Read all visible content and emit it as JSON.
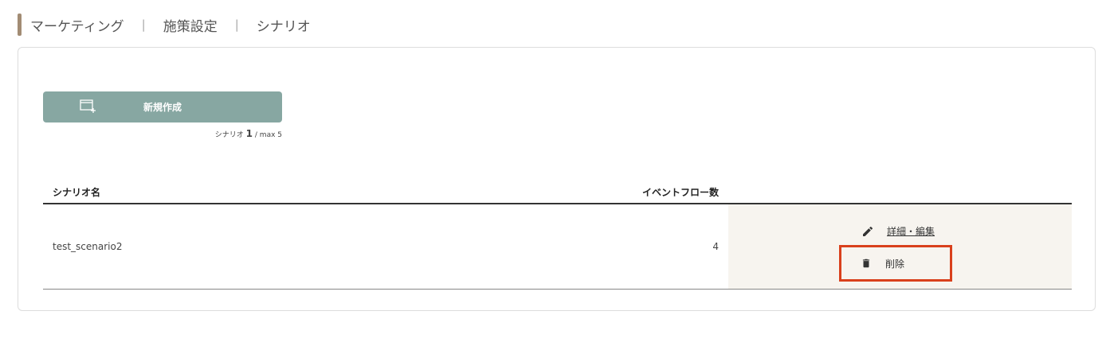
{
  "breadcrumb": {
    "items": [
      "マーケティング",
      "施策設定",
      "シナリオ"
    ],
    "separator": "|"
  },
  "toolbar": {
    "new_button_label": "新規作成",
    "new_icon": "new-window-icon",
    "count_prefix": "シナリオ",
    "count_current": "1",
    "count_suffix": "/ max 5"
  },
  "table": {
    "headers": {
      "name": "シナリオ名",
      "event_flow_count": "イベントフロー数"
    },
    "rows": [
      {
        "name": "test_scenario2",
        "event_flow_count": "4",
        "edit_label": "詳細・編集",
        "delete_label": "削除"
      }
    ]
  },
  "icons": {
    "edit": "pencil-icon",
    "delete": "trash-icon"
  },
  "colors": {
    "accent": "#a28c74",
    "button": "#87a7a2",
    "actions_bg": "#f7f4ef",
    "highlight": "#d9401c"
  }
}
